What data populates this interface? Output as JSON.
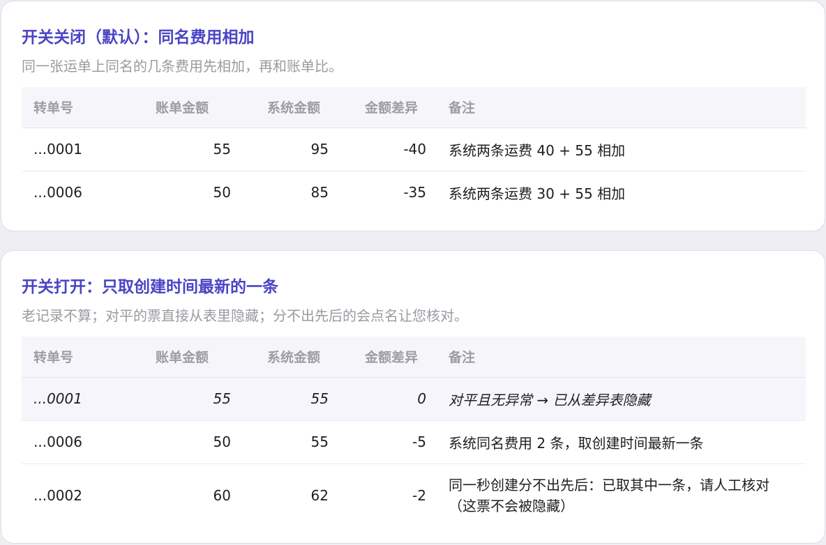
{
  "card1": {
    "title": "开关关闭（默认）：同名费用相加",
    "subtitle": "同一张运单上同名的几条费用先相加，再和账单比。",
    "columns": [
      "转单号",
      "账单金额",
      "系统金额",
      "金额差异",
      "备注"
    ],
    "rows": [
      {
        "id": "...0001",
        "bill": "55",
        "system": "95",
        "diff": "-40",
        "note": "系统两条运费 40 + 55 相加"
      },
      {
        "id": "...0006",
        "bill": "50",
        "system": "85",
        "diff": "-35",
        "note": "系统两条运费 30 + 55 相加"
      }
    ]
  },
  "card2": {
    "title": "开关打开：只取创建时间最新的一条",
    "subtitle": "老记录不算；对平的票直接从表里隐藏；分不出先后的会点名让您核对。",
    "columns": [
      "转单号",
      "账单金额",
      "系统金额",
      "金额差异",
      "备注"
    ],
    "rows": [
      {
        "id": "...0001",
        "bill": "55",
        "system": "55",
        "diff": "0",
        "note": "对平且无异常 → 已从差异表隐藏"
      },
      {
        "id": "...0006",
        "bill": "50",
        "system": "55",
        "diff": "-5",
        "note": "系统同名费用 2 条，取创建时间最新一条"
      },
      {
        "id": "...0002",
        "bill": "60",
        "system": "62",
        "diff": "-2",
        "note": "同一秒创建分不出先后：已取其中一条，请人工核对（这票不会被隐藏）"
      }
    ]
  },
  "colors": {
    "accent": "#4a44c6",
    "subtitle": "#9a9aa2",
    "header_bg": "#f6f6fa",
    "hidden_row_bg": "#f5f5fb"
  }
}
